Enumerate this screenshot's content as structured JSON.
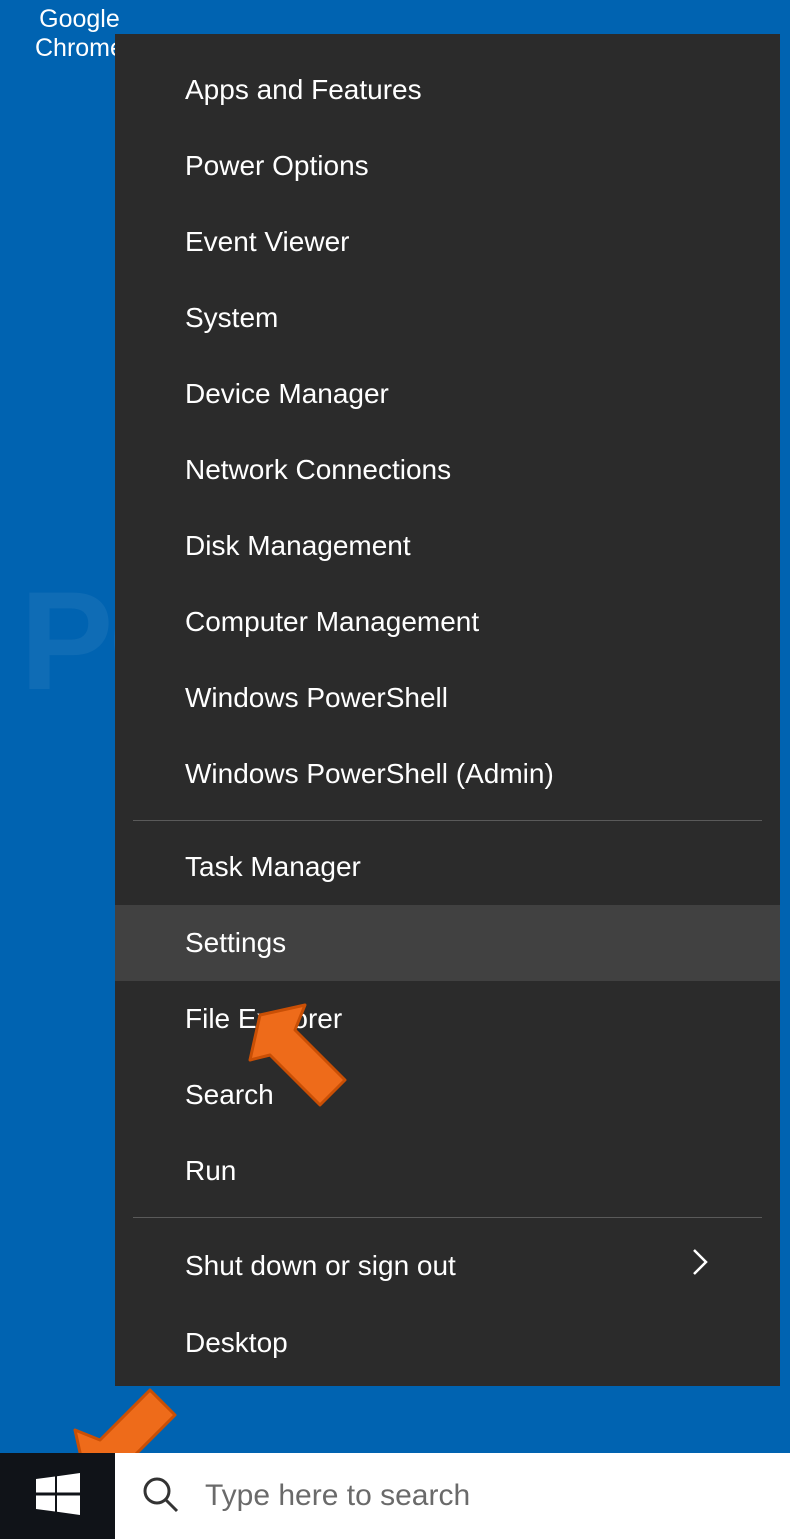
{
  "desktop": {
    "chrome_label_line1": "Google",
    "chrome_label_line2": "Chrome"
  },
  "menu": {
    "group1": [
      "Apps and Features",
      "Power Options",
      "Event Viewer",
      "System",
      "Device Manager",
      "Network Connections",
      "Disk Management",
      "Computer Management",
      "Windows PowerShell",
      "Windows PowerShell (Admin)"
    ],
    "group2": [
      "Task Manager",
      "Settings",
      "File Explorer",
      "Search",
      "Run"
    ],
    "group3": [
      "Shut down or sign out",
      "Desktop"
    ],
    "highlighted": "Settings",
    "submenu_arrow": "Shut down or sign out"
  },
  "taskbar": {
    "search_placeholder": "Type here to search"
  },
  "watermark": "PCrisk.com"
}
